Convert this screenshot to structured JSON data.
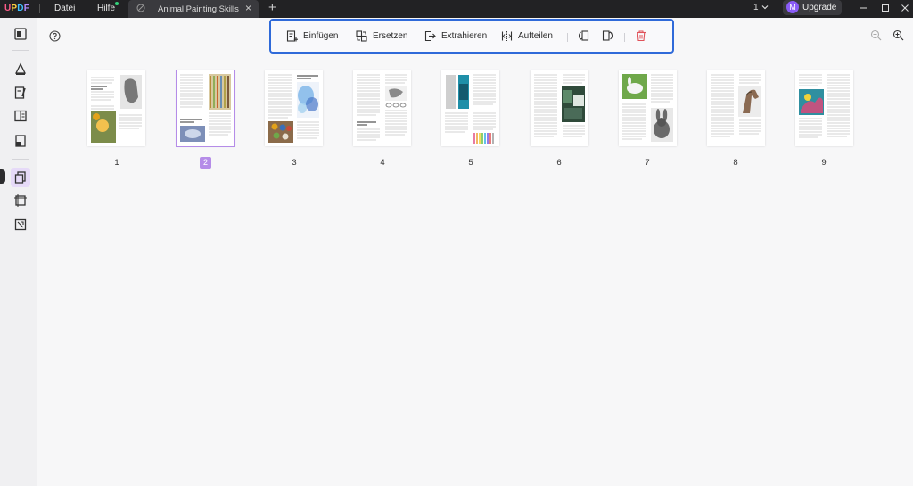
{
  "app": {
    "logo": [
      "U",
      "P",
      "D",
      "F"
    ],
    "menus": [
      "Datei",
      "Hilfe"
    ],
    "tab_title": "Animal Painting Skills",
    "tab_close": "×",
    "tab_add": "+",
    "page_indicator": "1",
    "upgrade_label": "Upgrade",
    "avatar_letter": "M"
  },
  "toolbar": {
    "insert": "Einfügen",
    "replace": "Ersetzen",
    "extract": "Extrahieren",
    "split": "Aufteilen"
  },
  "pages": [
    "1",
    "2",
    "3",
    "4",
    "5",
    "6",
    "7",
    "8",
    "9"
  ],
  "selected_page": "2",
  "colors": {
    "accent": "#2f6ad9",
    "selection": "#b58ce8",
    "delete": "#e0525a",
    "titlebar": "#222224"
  },
  "icons": {
    "sidebar": [
      "reader-icon",
      "comment-icon",
      "edit-icon",
      "form-icon",
      "protect-icon",
      "organize-pages-icon",
      "crop-icon",
      "compress-icon"
    ],
    "toolbar": [
      "insert-icon",
      "replace-icon",
      "extract-icon",
      "split-icon",
      "rotate-left-icon",
      "rotate-right-icon",
      "delete-icon"
    ]
  }
}
